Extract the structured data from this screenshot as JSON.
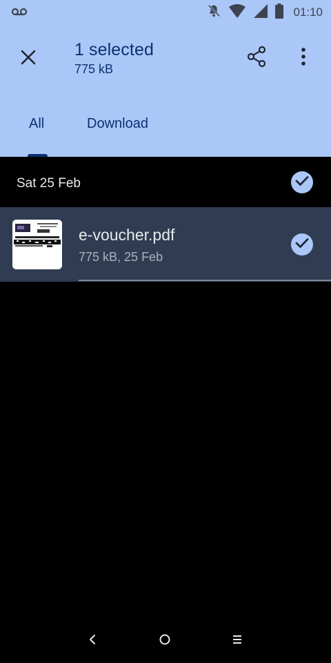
{
  "status_bar": {
    "time": "01:10",
    "icons": [
      "voicemail-icon",
      "notifications-off-icon",
      "wifi-icon",
      "signal-icon",
      "battery-icon"
    ]
  },
  "app_bar": {
    "title": "1 selected",
    "subtitle": "775 kB",
    "icons": [
      "close-icon",
      "share-icon",
      "more-vert-icon"
    ]
  },
  "tabs": [
    {
      "label": "All",
      "selected": true
    },
    {
      "label": "Download",
      "selected": false
    }
  ],
  "group": {
    "date": "Sat 25 Feb",
    "selected": true
  },
  "file": {
    "name": "e-voucher.pdf",
    "meta": "775 kB, 25 Feb",
    "selected": true,
    "thumbnail_icon": "pdf-thumbnail"
  },
  "navigation": {
    "icons": [
      "back-icon",
      "home-icon",
      "recents-icon"
    ]
  },
  "colors": {
    "header_bg": "#aac7f7",
    "header_text": "#0c3072",
    "selected_row_bg": "#2f3c52",
    "check_bg": "#aac7f7",
    "background": "#000000"
  }
}
